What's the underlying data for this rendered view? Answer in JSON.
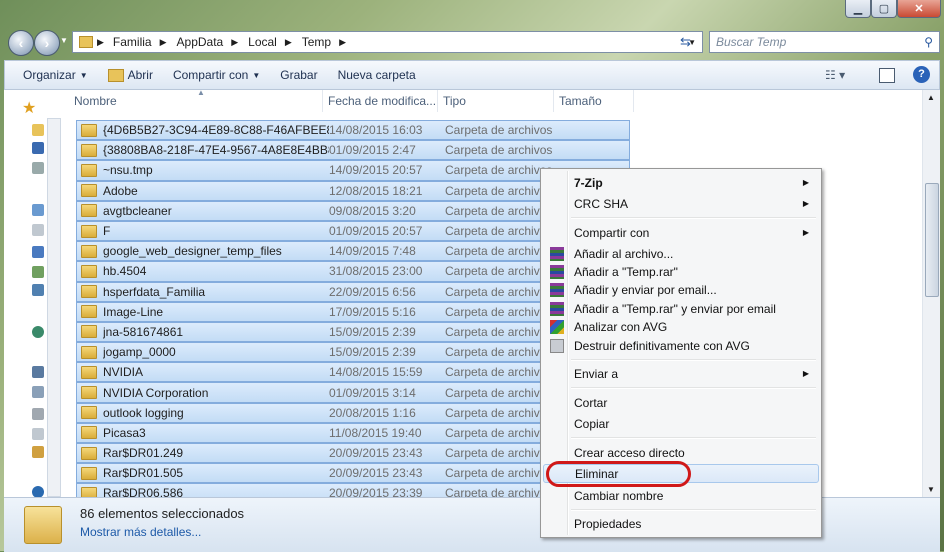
{
  "window": {
    "min": "▁",
    "max": "▢",
    "close": "✕"
  },
  "address": {
    "crumbs": [
      "Familia",
      "AppData",
      "Local",
      "Temp"
    ],
    "search_placeholder": "Buscar Temp"
  },
  "toolbar": {
    "organize": "Organizar",
    "open": "Abrir",
    "share": "Compartir con",
    "burn": "Grabar",
    "new_folder": "Nueva carpeta"
  },
  "columns": {
    "name": "Nombre",
    "modified": "Fecha de modifica...",
    "type": "Tipo",
    "size": "Tamaño"
  },
  "files": [
    {
      "name": "{4D6B5B27-3C94-4E89-8C88-F46AFBEE87...",
      "date": "14/08/2015 16:03",
      "type": "Carpeta de archivos"
    },
    {
      "name": "{38808BA8-218F-47E4-9567-4A8E8E4BB8...",
      "date": "01/09/2015 2:47",
      "type": "Carpeta de archivos"
    },
    {
      "name": "~nsu.tmp",
      "date": "14/09/2015 20:57",
      "type": "Carpeta de archivos"
    },
    {
      "name": "Adobe",
      "date": "12/08/2015 18:21",
      "type": "Carpeta de archivos"
    },
    {
      "name": "avgtbcleaner",
      "date": "09/08/2015 3:20",
      "type": "Carpeta de archivos"
    },
    {
      "name": "F",
      "date": "01/09/2015 20:57",
      "type": "Carpeta de archivos"
    },
    {
      "name": "google_web_designer_temp_files",
      "date": "14/09/2015 7:48",
      "type": "Carpeta de archivos"
    },
    {
      "name": "hb.4504",
      "date": "31/08/2015 23:00",
      "type": "Carpeta de archivos"
    },
    {
      "name": "hsperfdata_Familia",
      "date": "22/09/2015 6:56",
      "type": "Carpeta de archivos"
    },
    {
      "name": "Image-Line",
      "date": "17/09/2015 5:16",
      "type": "Carpeta de archivos"
    },
    {
      "name": "jna-581674861",
      "date": "15/09/2015 2:39",
      "type": "Carpeta de archivos"
    },
    {
      "name": "jogamp_0000",
      "date": "15/09/2015 2:39",
      "type": "Carpeta de archivos"
    },
    {
      "name": "NVIDIA",
      "date": "14/08/2015 15:59",
      "type": "Carpeta de archivos"
    },
    {
      "name": "NVIDIA Corporation",
      "date": "01/09/2015 3:14",
      "type": "Carpeta de archivos"
    },
    {
      "name": "outlook logging",
      "date": "20/08/2015 1:16",
      "type": "Carpeta de archivos"
    },
    {
      "name": "Picasa3",
      "date": "11/08/2015 19:40",
      "type": "Carpeta de archivos"
    },
    {
      "name": "Rar$DR01.249",
      "date": "20/09/2015 23:43",
      "type": "Carpeta de archivos"
    },
    {
      "name": "Rar$DR01.505",
      "date": "20/09/2015 23:43",
      "type": "Carpeta de archivos"
    },
    {
      "name": "Rar$DR06.586",
      "date": "20/09/2015 23:39",
      "type": "Carpeta de archivos"
    }
  ],
  "status": {
    "count": "86 elementos seleccionados",
    "details": "Mostrar más detalles..."
  },
  "context_menu": {
    "zip": "7-Zip",
    "crc": "CRC SHA",
    "share": "Compartir con",
    "add_archive": "Añadir al archivo...",
    "add_temp_rar": "Añadir a \"Temp.rar\"",
    "add_email": "Añadir y enviar por email...",
    "add_temp_rar_email": "Añadir a \"Temp.rar\" y enviar por email",
    "avg_scan": "Analizar con AVG",
    "avg_shred": "Destruir definitivamente con AVG",
    "send_to": "Enviar a",
    "cut": "Cortar",
    "copy": "Copiar",
    "shortcut": "Crear acceso directo",
    "delete": "Eliminar",
    "rename": "Cambiar nombre",
    "properties": "Propiedades"
  },
  "colors": {
    "selection": "#c3dcf5",
    "highlight_oval": "#d01818",
    "link": "#1d5aa8"
  }
}
